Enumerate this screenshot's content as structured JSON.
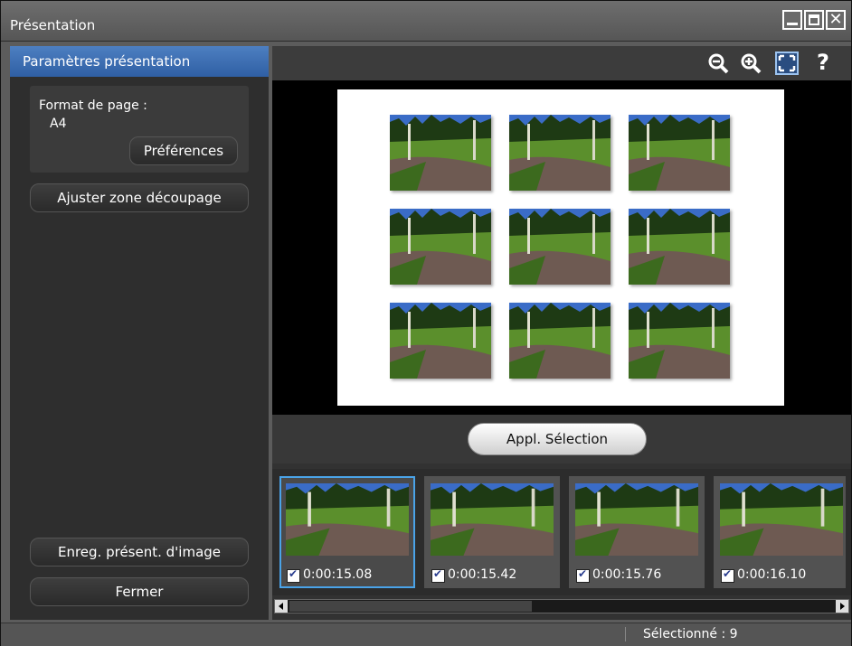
{
  "window": {
    "title": "Présentation"
  },
  "left_panel": {
    "header": "Paramètres présentation",
    "format_label": "Format de page :",
    "format_value": "A4",
    "preferences_button": "Préférences",
    "adjust_crop_button": "Ajuster zone découpage",
    "save_button": "Enreg. présent. d'image",
    "close_button": "Fermer"
  },
  "toolbar": {
    "icons": [
      "zoom-out-icon",
      "zoom-in-icon",
      "fit-to-window-icon",
      "help-icon"
    ],
    "help_glyph": "?"
  },
  "preview": {
    "thumbnail_count": 9
  },
  "apply_button": "Appl. Sélection",
  "filmstrip": {
    "frames": [
      {
        "timecode": "0:00:15.08",
        "checked": true,
        "selected": true
      },
      {
        "timecode": "0:00:15.42",
        "checked": true,
        "selected": false
      },
      {
        "timecode": "0:00:15.76",
        "checked": true,
        "selected": false
      },
      {
        "timecode": "0:00:16.10",
        "checked": true,
        "selected": false
      }
    ]
  },
  "status": {
    "selected_text": "Sélectionné : 9"
  },
  "colors": {
    "accent": "#3a6db4",
    "selection_border": "#4aa3e8"
  }
}
